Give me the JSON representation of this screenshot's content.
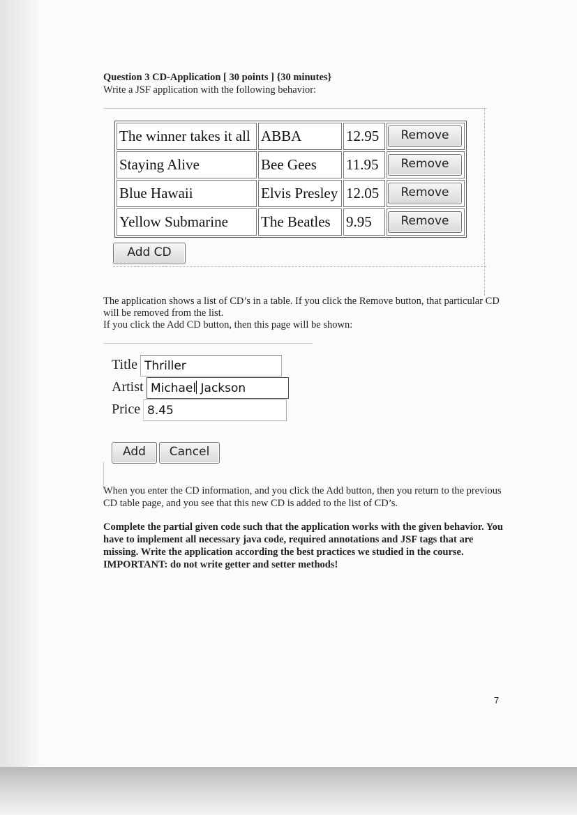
{
  "question": {
    "title": "Question 3 CD-Application [ 30 points ] {30 minutes}",
    "subtitle": "Write a JSF application with the following behavior:"
  },
  "cd_table": {
    "rows": [
      {
        "title": "The winner takes it all",
        "artist": "ABBA",
        "price": "12.95",
        "button": "Remove"
      },
      {
        "title": "Staying Alive",
        "artist": "Bee Gees",
        "price": "11.95",
        "button": "Remove"
      },
      {
        "title": "Blue Hawaii",
        "artist": "Elvis Presley",
        "price": "12.05",
        "button": "Remove"
      },
      {
        "title": "Yellow Submarine",
        "artist": "The Beatles",
        "price": "9.95",
        "button": "Remove"
      }
    ],
    "add_button": "Add CD"
  },
  "paragraph1": "The application shows a list of CD’s in a table. If you click the Remove button, that particular CD will be removed from the list.",
  "paragraph2": "If you click the Add CD button, then this page will be shown:",
  "add_form": {
    "title_label": "Title",
    "title_value": "Thriller",
    "artist_label": "Artist",
    "artist_value_before_cursor": "Michael",
    "artist_value_after_cursor": " Jackson",
    "price_label": "Price",
    "price_value": "8.45",
    "add_button": "Add",
    "cancel_button": "Cancel"
  },
  "paragraph3": "When you enter the CD information, and you click the Add button, then you return to the previous CD table page, and you see that this new CD is added to the list of CD’s.",
  "paragraph4": "Complete the partial given code such that the application works with the given behavior. You have to implement all necessary java code, required annotations and JSF tags that are missing. Write the application according the best practices we studied in the course. IMPORTANT: do not write getter and setter methods!",
  "page_number": "7"
}
